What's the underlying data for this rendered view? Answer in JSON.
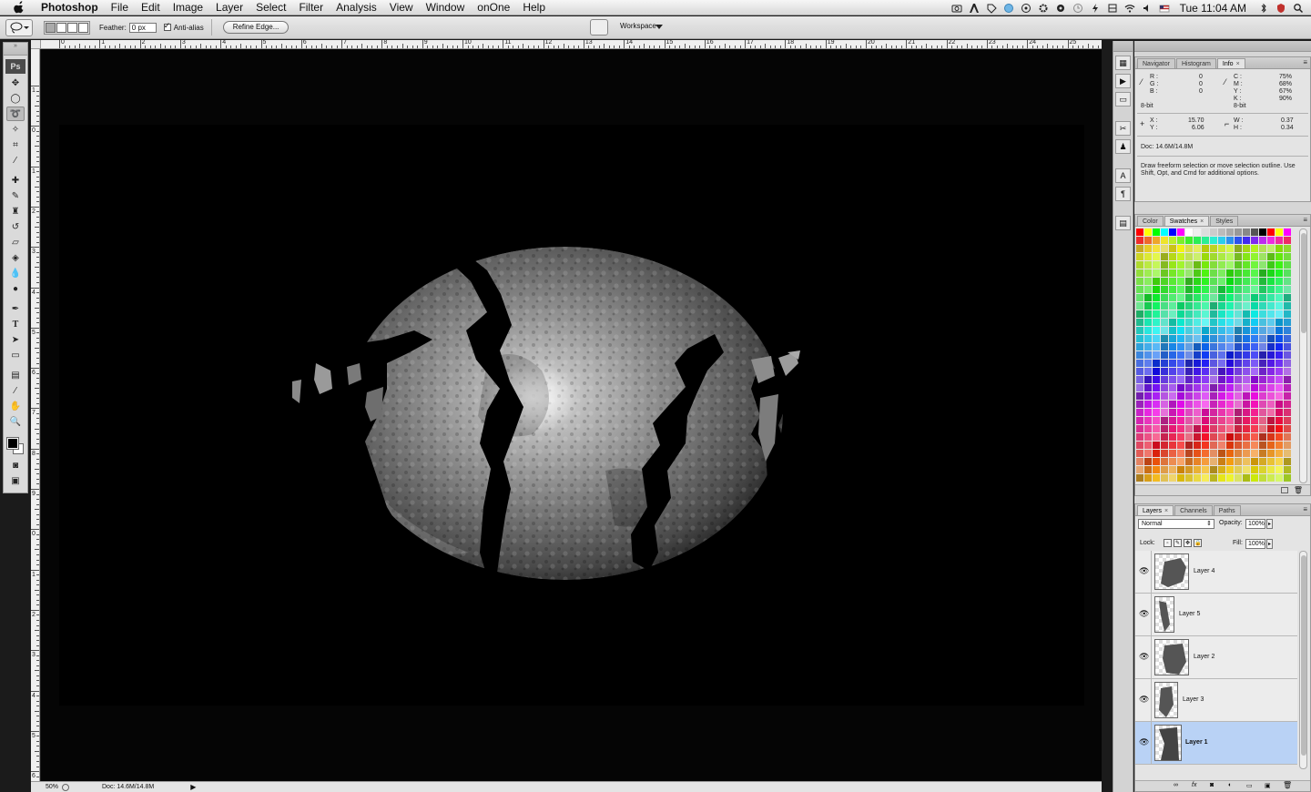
{
  "menubar": {
    "app_name": "Photoshop",
    "menus": [
      "File",
      "Edit",
      "Image",
      "Layer",
      "Select",
      "Filter",
      "Analysis",
      "View",
      "Window",
      "onOne",
      "Help"
    ],
    "clock": "Tue 11:04 AM"
  },
  "options": {
    "feather_label": "Feather:",
    "feather_value": "0 px",
    "antialias_label": "Anti-alias",
    "refine_edge_label": "Refine Edge...",
    "workspace_label": "Workspace"
  },
  "toolbox": {
    "logo": "Ps",
    "active_tool": "lasso-tool"
  },
  "rulers": {
    "h_numbers": [
      "0",
      "1",
      "2",
      "3",
      "4",
      "5",
      "6",
      "7",
      "8",
      "9",
      "10",
      "11",
      "12",
      "13",
      "14",
      "15",
      "16",
      "17",
      "18",
      "19",
      "20",
      "21",
      "22",
      "23",
      "24",
      "25"
    ],
    "v_numbers": [
      "1",
      "0",
      "1",
      "2",
      "3",
      "4",
      "5",
      "6",
      "7",
      "8",
      "9",
      "0",
      "1",
      "2",
      "3",
      "4",
      "5",
      "6"
    ]
  },
  "status": {
    "zoom": "50%",
    "doc": "Doc: 14.6M/14.8M"
  },
  "info_panel": {
    "tabs": [
      "Navigator",
      "Histogram",
      "Info"
    ],
    "active_tab": "Info",
    "rgb": {
      "R": "0",
      "G": "0",
      "B": "0"
    },
    "cmyk": {
      "C": "75%",
      "M": "68%",
      "Y": "67%",
      "K": "90%"
    },
    "bit_left": "8-bit",
    "bit_right": "8-bit",
    "xy": {
      "X": "15.70",
      "Y": "6.06"
    },
    "wh": {
      "W": "0.37",
      "H": "0.34"
    },
    "doc": "Doc: 14.6M/14.8M",
    "hint": "Draw freeform selection or move selection outline. Use Shift, Opt, and Cmd for additional options."
  },
  "swatch_panel": {
    "tabs": [
      "Color",
      "Swatches",
      "Styles"
    ],
    "active_tab": "Swatches"
  },
  "layers_panel": {
    "tabs": [
      "Layers",
      "Channels",
      "Paths"
    ],
    "active_tab": "Layers",
    "blend_mode": "Normal",
    "opacity_label": "Opacity:",
    "opacity": "100%",
    "lock_label": "Lock:",
    "fill_label": "Fill:",
    "fill": "100%",
    "layers": [
      {
        "name": "Layer 4",
        "selected": false
      },
      {
        "name": "Layer 5",
        "selected": false
      },
      {
        "name": "Layer 2",
        "selected": false
      },
      {
        "name": "Layer 3",
        "selected": false
      },
      {
        "name": "Layer 1",
        "selected": true
      }
    ]
  },
  "colors": {
    "selection_blue": "#b9d2f5",
    "canvas": "#000000",
    "pasteboard": "#050505"
  }
}
